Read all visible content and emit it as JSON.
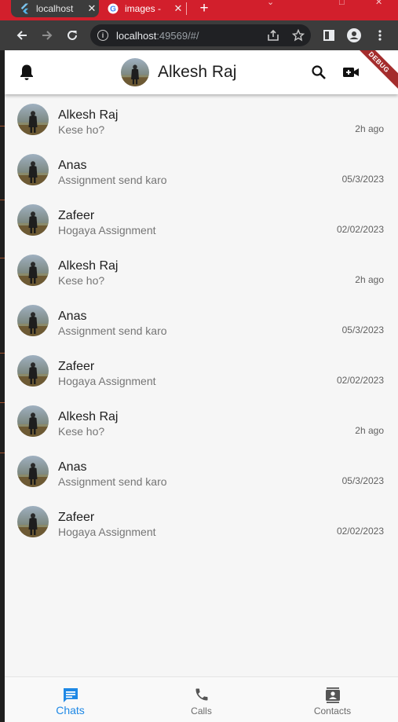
{
  "browser": {
    "tabs": [
      {
        "title": "localhost",
        "active": true,
        "icon": "flutter-icon"
      },
      {
        "title": "images -",
        "active": false,
        "icon": "google-icon"
      }
    ],
    "new_tab_label": "+",
    "url_host": "localhost",
    "url_rest": ":49569/#/"
  },
  "app": {
    "title": "Alkesh Raj",
    "debug_label": "DEBUG",
    "colors": {
      "accent": "#1e88e5",
      "tabstrip": "#d21f2c",
      "debug": "#a42d2d"
    }
  },
  "chats": [
    {
      "name": "Alkesh Raj",
      "message": "Kese ho?",
      "time": "2h ago"
    },
    {
      "name": "Anas",
      "message": "Assignment send karo",
      "time": "05/3/2023"
    },
    {
      "name": "Zafeer",
      "message": "Hogaya Assignment",
      "time": "02/02/2023"
    },
    {
      "name": "Alkesh Raj",
      "message": "Kese ho?",
      "time": "2h ago"
    },
    {
      "name": "Anas",
      "message": "Assignment send karo",
      "time": "05/3/2023"
    },
    {
      "name": "Zafeer",
      "message": "Hogaya Assignment",
      "time": "02/02/2023"
    },
    {
      "name": "Alkesh Raj",
      "message": "Kese ho?",
      "time": "2h ago"
    },
    {
      "name": "Anas",
      "message": "Assignment send karo",
      "time": "05/3/2023"
    },
    {
      "name": "Zafeer",
      "message": "Hogaya Assignment",
      "time": "02/02/2023"
    }
  ],
  "bottom_nav": [
    {
      "label": "Chats",
      "icon": "chat-icon",
      "active": true
    },
    {
      "label": "Calls",
      "icon": "phone-icon",
      "active": false
    },
    {
      "label": "Contacts",
      "icon": "contacts-icon",
      "active": false
    }
  ]
}
